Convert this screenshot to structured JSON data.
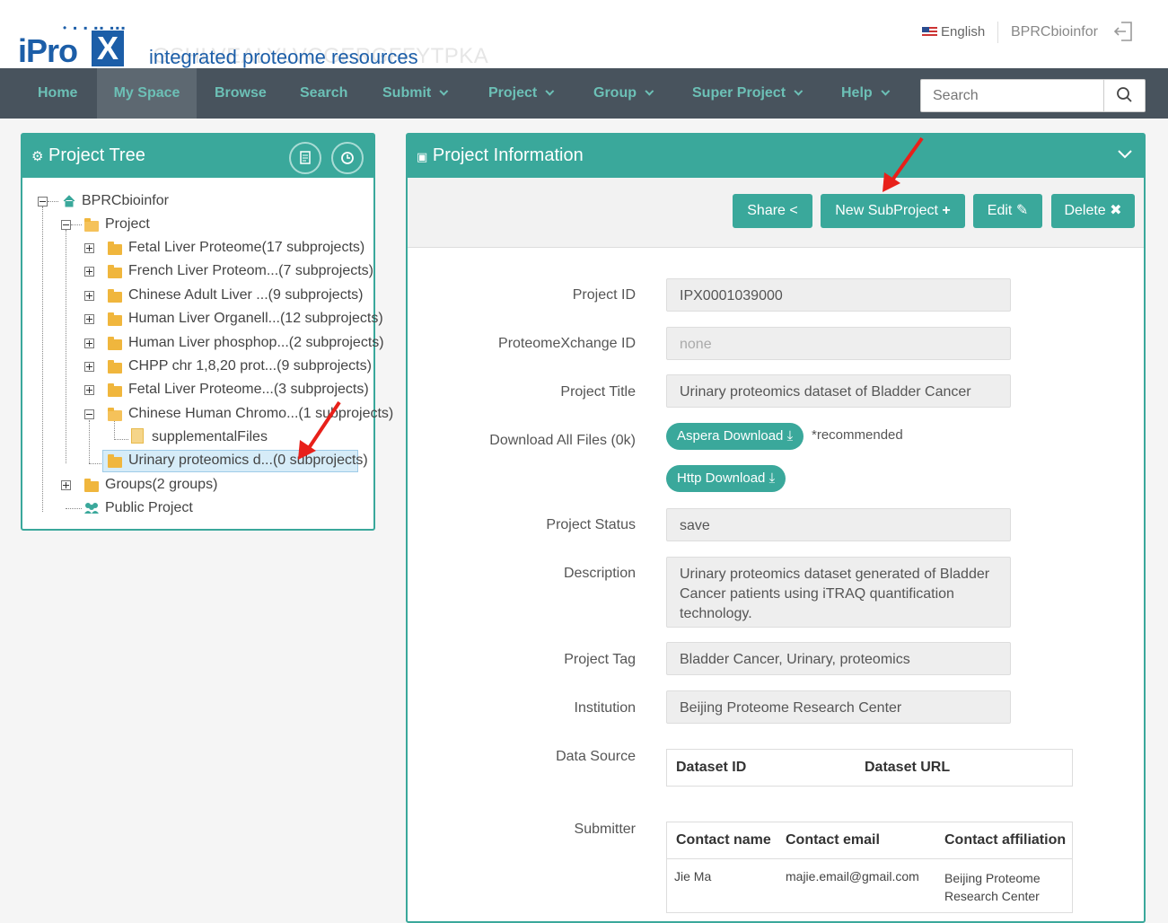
{
  "header": {
    "logo_ipro": "iPro",
    "logo_x": "X",
    "logo_tagline": "integrated proteome resources",
    "logo_watermark": "GSHLVEALYLVCGERGFFYTPKA",
    "language": "English",
    "username": "BPRCbioinfor"
  },
  "nav": {
    "items": [
      {
        "label": "Home"
      },
      {
        "label": "My Space"
      },
      {
        "label": "Browse"
      },
      {
        "label": "Search"
      },
      {
        "label": "Submit"
      },
      {
        "label": "Project"
      },
      {
        "label": "Group"
      },
      {
        "label": "Super Project"
      },
      {
        "label": "Help"
      }
    ],
    "search_placeholder": "Search"
  },
  "tree": {
    "title": "Project Tree",
    "root": "BPRCbioinfor",
    "project": "Project",
    "children": [
      "Fetal Liver Proteome(17 subprojects)",
      "French Liver Proteom...(7 subprojects)",
      "Chinese Adult Liver ...(9 subprojects)",
      "Human Liver Organell...(12 subprojects)",
      "Human Liver phosphop...(2 subprojects)",
      "CHPP chr 1,8,20 prot...(9 subprojects)",
      "Fetal Liver Proteome...(3 subprojects)",
      "Chinese Human Chromo...(1 subprojects)"
    ],
    "supplemental": "supplementalFiles",
    "selected": "Urinary proteomics d...(0 subprojects)",
    "groups": "Groups(2 groups)",
    "public": "Public Project"
  },
  "info": {
    "title": "Project Information",
    "buttons": {
      "share": "Share",
      "new_subproject": "New SubProject",
      "edit": "Edit",
      "delete": "Delete"
    },
    "labels": {
      "project_id": "Project ID",
      "px_id": "ProteomeXchange ID",
      "title": "Project Title",
      "download": "Download All Files (0k)",
      "status": "Project Status",
      "description": "Description",
      "tag": "Project Tag",
      "institution": "Institution",
      "data_source": "Data Source",
      "submitter": "Submitter"
    },
    "values": {
      "project_id": "IPX0001039000",
      "px_id": "none",
      "title": "Urinary proteomics dataset of Bladder Cancer",
      "aspera": "Aspera Download",
      "recommended": "*recommended",
      "http": "Http Download",
      "status": "save",
      "description": "Urinary proteomics dataset generated of Bladder Cancer patients using iTRAQ quantification technology.",
      "tag": "Bladder Cancer, Urinary, proteomics",
      "institution": "Beijing Proteome Research Center"
    },
    "data_source_table": {
      "headers": [
        "Dataset ID",
        "Dataset URL"
      ]
    },
    "submitter_table": {
      "headers": [
        "Contact name",
        "Contact email",
        "Contact affiliation"
      ],
      "row": [
        "Jie Ma",
        "majie.email@gmail.com",
        "Beijing Proteome Research Center"
      ]
    }
  },
  "colors": {
    "accent": "#3aa89b",
    "nav_bg": "#48535d",
    "nav_text": "#6cc0b6",
    "logo": "#1c5ea8",
    "annotation_arrow": "#e8201a"
  }
}
